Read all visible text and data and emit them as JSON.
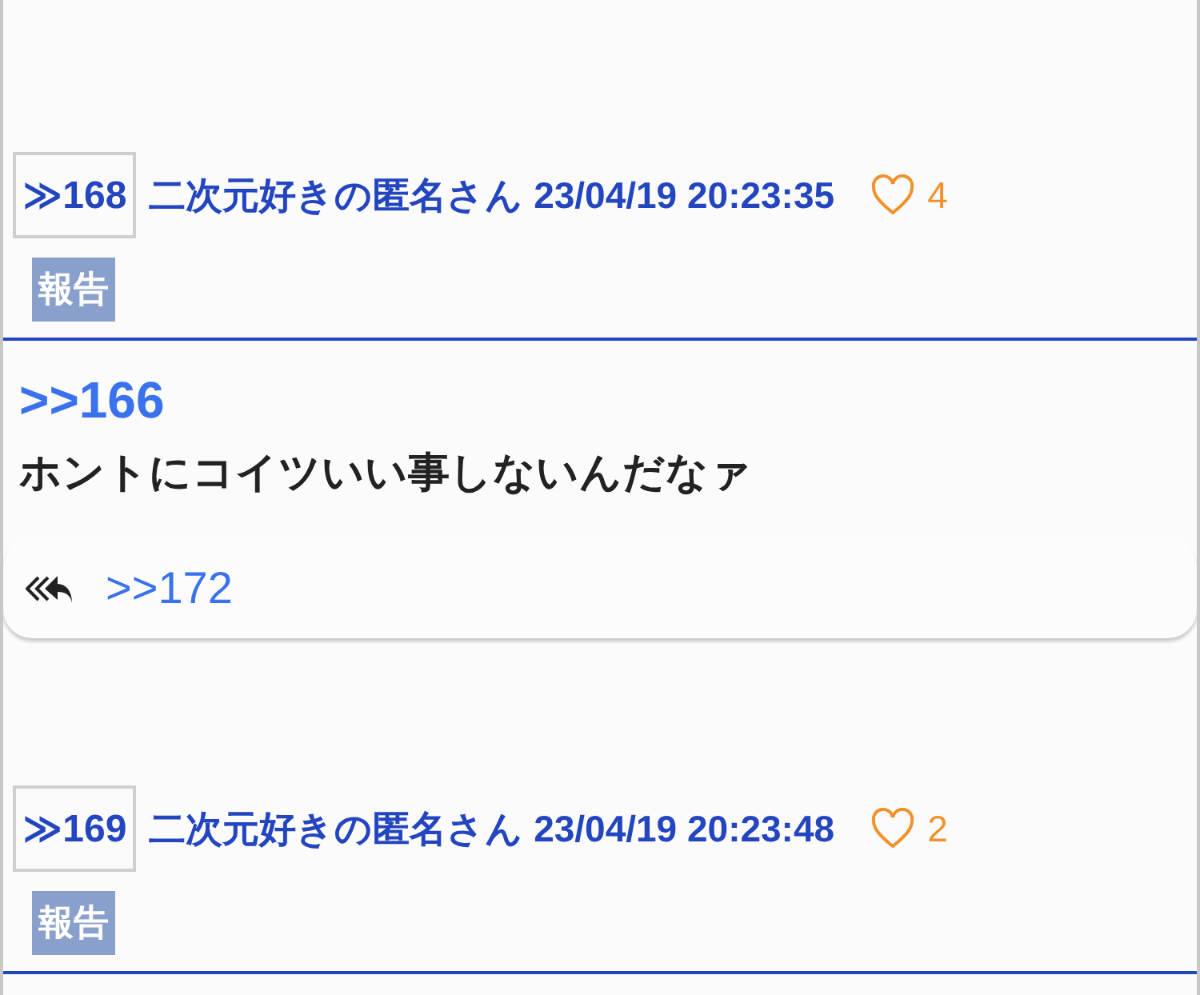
{
  "posts": [
    {
      "number": "≫168",
      "author": "二次元好きの匿名さん",
      "timestamp": "23/04/19 20:23:35",
      "likes": "4",
      "report": "報告",
      "anchor": ">>166",
      "body": "ホントにコイツいい事しないんだなァ",
      "replies": [
        ">>172"
      ]
    },
    {
      "number": "≫169",
      "author": "二次元好きの匿名さん",
      "timestamp": "23/04/19 20:23:48",
      "likes": "2",
      "report": "報告"
    }
  ]
}
